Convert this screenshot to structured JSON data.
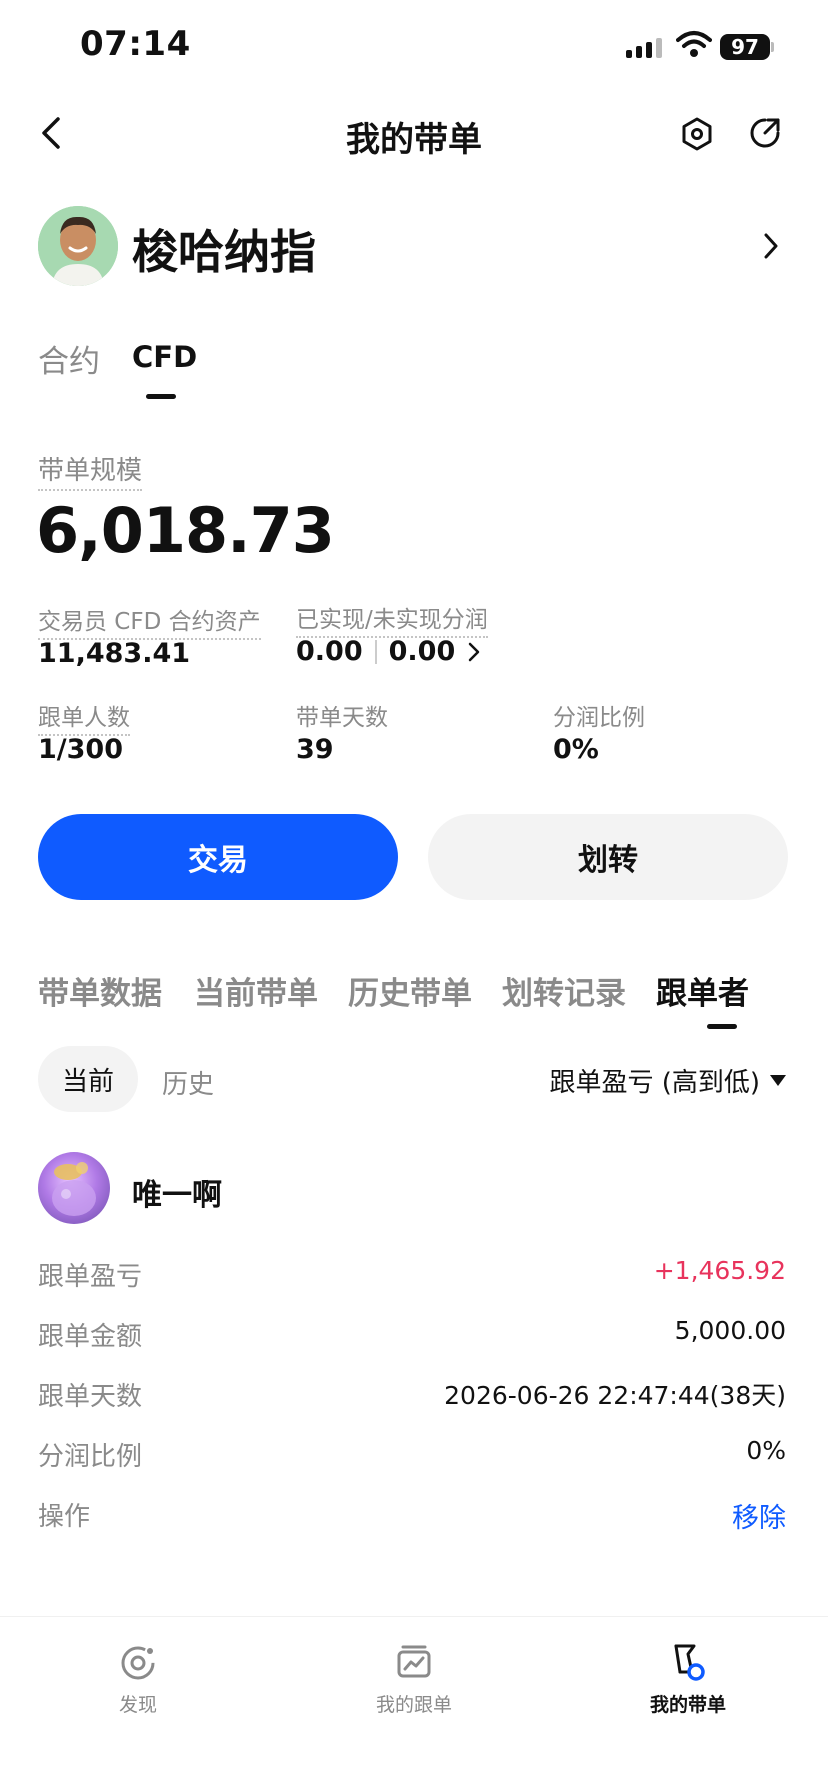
{
  "status_bar": {
    "time": "07:14",
    "battery": "97"
  },
  "header": {
    "title": "我的带单",
    "icons": [
      "back-icon",
      "hexagon-settings-icon",
      "share-icon"
    ]
  },
  "profile": {
    "name": "梭哈纳指"
  },
  "product_tabs": {
    "items": [
      "合约",
      "CFD"
    ],
    "active": "CFD"
  },
  "summary": {
    "scale_label": "带单规模",
    "scale_value": "6,018.73",
    "stats": {
      "trader_assets_label": "交易员 CFD 合约资产",
      "trader_assets_value": "11,483.41",
      "profit_share_label": "已实现/未实现分润",
      "realized_value": "0.00",
      "unrealized_value": "0.00",
      "followers_label": "跟单人数",
      "followers_value": "1/300",
      "days_label": "带单天数",
      "days_value": "39",
      "share_ratio_label": "分润比例",
      "share_ratio_value": "0%"
    }
  },
  "actions": {
    "trade_label": "交易",
    "transfer_label": "划转"
  },
  "section_tabs": {
    "items": [
      "带单数据",
      "当前带单",
      "历史带单",
      "划转记录",
      "跟单者"
    ],
    "active": "跟单者"
  },
  "sub_tabs": {
    "current": "当前",
    "history": "历史",
    "sort": "跟单盈亏 (高到低)"
  },
  "follower": {
    "name": "唯一啊",
    "rows": [
      {
        "label": "跟单盈亏",
        "value": "+1,465.92"
      },
      {
        "label": "跟单金额",
        "value": "5,000.00"
      },
      {
        "label": "跟单天数",
        "value": "2026-06-26 22:47:44(38天)"
      },
      {
        "label": "分润比例",
        "value": "0%"
      },
      {
        "label": "操作",
        "value": "移除"
      }
    ]
  },
  "bottom_nav": {
    "items": [
      {
        "label": "发现",
        "icon": "discover-icon"
      },
      {
        "label": "我的跟单",
        "icon": "my-copy-icon"
      },
      {
        "label": "我的带单",
        "icon": "my-lead-icon"
      }
    ],
    "active": "我的带单"
  },
  "colors": {
    "accent": "#0f5bff",
    "profit": "#e8335c",
    "muted": "#8a8a8a"
  }
}
